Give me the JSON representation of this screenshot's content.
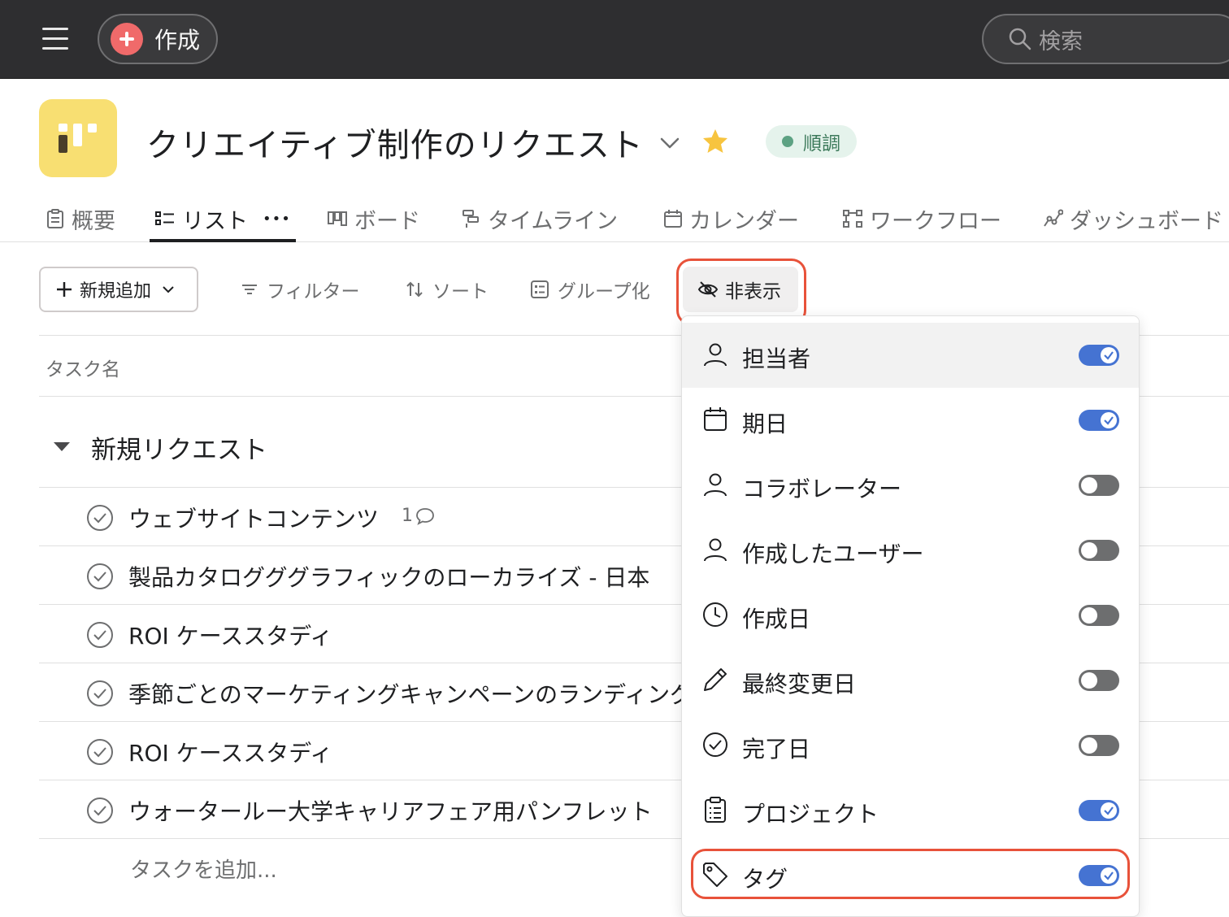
{
  "topbar": {
    "create_label": "作成",
    "search_placeholder": "検索"
  },
  "project": {
    "title": "クリエイティブ制作のリクエスト",
    "status": "順調",
    "icon_color": "#f8df72",
    "status_color": "#5da283"
  },
  "tabs": [
    {
      "label": "概要",
      "icon": "clipboard-icon"
    },
    {
      "label": "リスト",
      "icon": "list-icon",
      "active": true,
      "more": "•••"
    },
    {
      "label": "ボード",
      "icon": "board-icon"
    },
    {
      "label": "タイムライン",
      "icon": "timeline-icon"
    },
    {
      "label": "カレンダー",
      "icon": "calendar-icon"
    },
    {
      "label": "ワークフロー",
      "icon": "workflow-icon"
    },
    {
      "label": "ダッシュボード",
      "icon": "dashboard-icon"
    }
  ],
  "toolbar": {
    "add_label": "新規追加",
    "filter_label": "フィルター",
    "sort_label": "ソート",
    "group_label": "グループ化",
    "hide_label": "非表示"
  },
  "table": {
    "column_task": "タスク名",
    "section_title": "新規リクエスト",
    "rows": [
      {
        "name": "ウェブサイトコンテンツ",
        "comments": "1"
      },
      {
        "name": "製品カタログググラフィックのローカライズ - 日本"
      },
      {
        "name": "ROI ケーススタディ"
      },
      {
        "name": "季節ごとのマーケティングキャンペーンのランディング"
      },
      {
        "name": "ROI ケーススタディ"
      },
      {
        "name": "ウォータールー大学キャリアフェア用パンフレット"
      }
    ],
    "add_task": "タスクを追加..."
  },
  "menu": {
    "items": [
      {
        "label": "担当者",
        "icon": "person-icon",
        "on": true
      },
      {
        "label": "期日",
        "icon": "calendar-icon",
        "on": true
      },
      {
        "label": "コラボレーター",
        "icon": "person-icon",
        "on": false
      },
      {
        "label": "作成したユーザー",
        "icon": "person-icon",
        "on": false
      },
      {
        "label": "作成日",
        "icon": "clock-icon",
        "on": false
      },
      {
        "label": "最終変更日",
        "icon": "pencil-icon",
        "on": false
      },
      {
        "label": "完了日",
        "icon": "check-circle-icon",
        "on": false
      },
      {
        "label": "プロジェクト",
        "icon": "clipboard-icon",
        "on": true
      },
      {
        "label": "タグ",
        "icon": "tag-icon",
        "on": true
      }
    ],
    "toggle_on_color": "#4573d2",
    "highlight_color": "#e8523a"
  }
}
